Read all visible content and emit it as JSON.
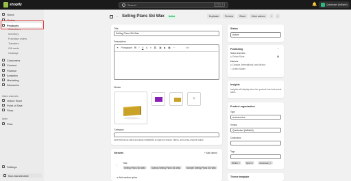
{
  "topbar": {
    "logo_text": "shopify",
    "search_placeholder": "Search",
    "search_shortcut": "CTRL K",
    "store_name": "Quickstart (6d5ab0)"
  },
  "sidebar": {
    "items": [
      {
        "label": "Home"
      },
      {
        "label": "Orders"
      },
      {
        "label": "Products"
      },
      {
        "label": "Collections"
      },
      {
        "label": "Inventory"
      },
      {
        "label": "Purchase orders"
      },
      {
        "label": "Transfers"
      },
      {
        "label": "Gift cards"
      },
      {
        "label": "Catalogs"
      },
      {
        "label": "Customers"
      },
      {
        "label": "Content"
      },
      {
        "label": "Finance"
      },
      {
        "label": "Analytics"
      },
      {
        "label": "Marketing"
      },
      {
        "label": "Discounts"
      }
    ],
    "sales_channels_label": "Sales channels",
    "channels": [
      {
        "label": "Online Store"
      },
      {
        "label": "Point of Sale"
      },
      {
        "label": "Shop"
      }
    ],
    "apps_label": "Apps",
    "apps": [
      {
        "label": "Flow"
      }
    ],
    "settings_label": "Settings",
    "non_transferable_label": "Non-transferable"
  },
  "header": {
    "title": "Selling Plans Ski Wax",
    "status_badge": "Active",
    "actions": [
      "Duplicate",
      "Preview",
      "Share",
      "More actions"
    ]
  },
  "product": {
    "title_label": "Title",
    "title_value": "Selling Plans Ski Wax",
    "description_label": "Description",
    "toolbar_paragraph": "Paragraph",
    "toolbar_items": [
      "B",
      "I",
      "U",
      "A"
    ],
    "media_label": "Media",
    "category_label": "Category",
    "category_help": "Determines tax rates and adds metafields to improve search, filters, and cross-channel sales",
    "variants_label": "Variants",
    "add_variant": "+ Add variant",
    "option_name": "Title",
    "option_values": [
      "Selling Plans Ski Wax",
      "Special Selling Plans Ski Wax",
      "Sample Selling Plans Ski Wax"
    ],
    "add_option": "Add another option"
  },
  "status_card": {
    "label": "Status",
    "value": "Active"
  },
  "publishing_card": {
    "label": "Publishing",
    "sales_channels_label": "Sales channels",
    "channels": [
      "Online Store"
    ],
    "markets_label": "Markets",
    "markets": [
      "Canada, International, and Mexico",
      "United States"
    ]
  },
  "insights_card": {
    "label": "Insights",
    "text": "Insights will display when the product has had recent sales"
  },
  "organization_card": {
    "label": "Product organization",
    "type_label": "Type",
    "type_value": "accessories",
    "vendor_label": "Vendor",
    "vendor_value": "Quickstart (6d5ab0)",
    "collections_label": "Collections",
    "tags_label": "Tags",
    "tags": [
      "Winter",
      "Sport",
      "Accessory"
    ]
  },
  "theme_card": {
    "label": "Theme template"
  },
  "colors": {
    "topbar": "#1a1a1a",
    "highlight": "#e23b3b",
    "wax": "#c9a227",
    "wax_purple": "#8a1fb8"
  }
}
